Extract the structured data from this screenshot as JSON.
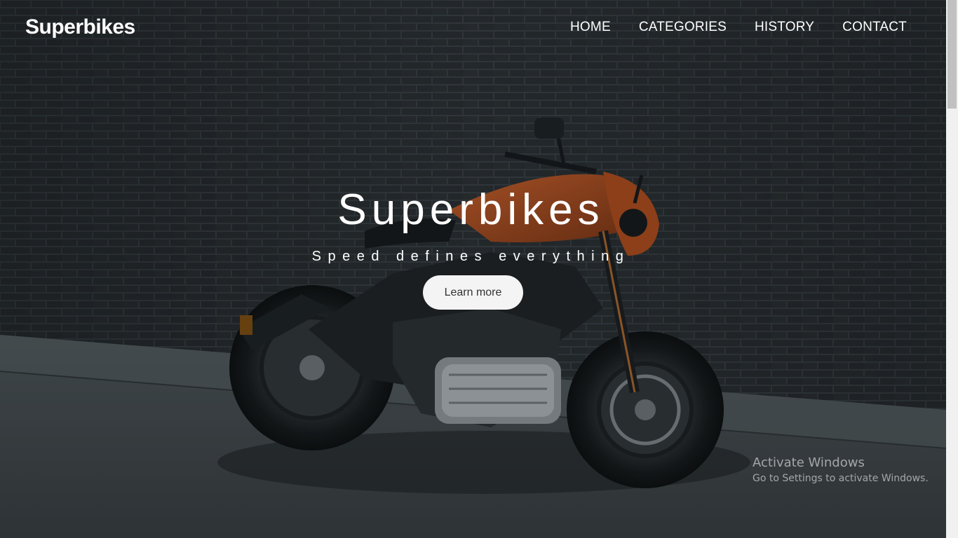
{
  "brand": "Superbikes",
  "nav": {
    "items": [
      "HOME",
      "CATEGORIES",
      "HISTORY",
      "CONTACT"
    ]
  },
  "hero": {
    "title": "Superbikes",
    "tagline": "Speed defines everything",
    "button_label": "Learn more"
  },
  "watermark": {
    "title": "Activate Windows",
    "subtitle": "Go to Settings to activate Windows."
  },
  "colors": {
    "text": "#ffffff",
    "button_bg": "#f4f4f4",
    "button_text": "#333333",
    "bike_accent": "#b4501f"
  }
}
